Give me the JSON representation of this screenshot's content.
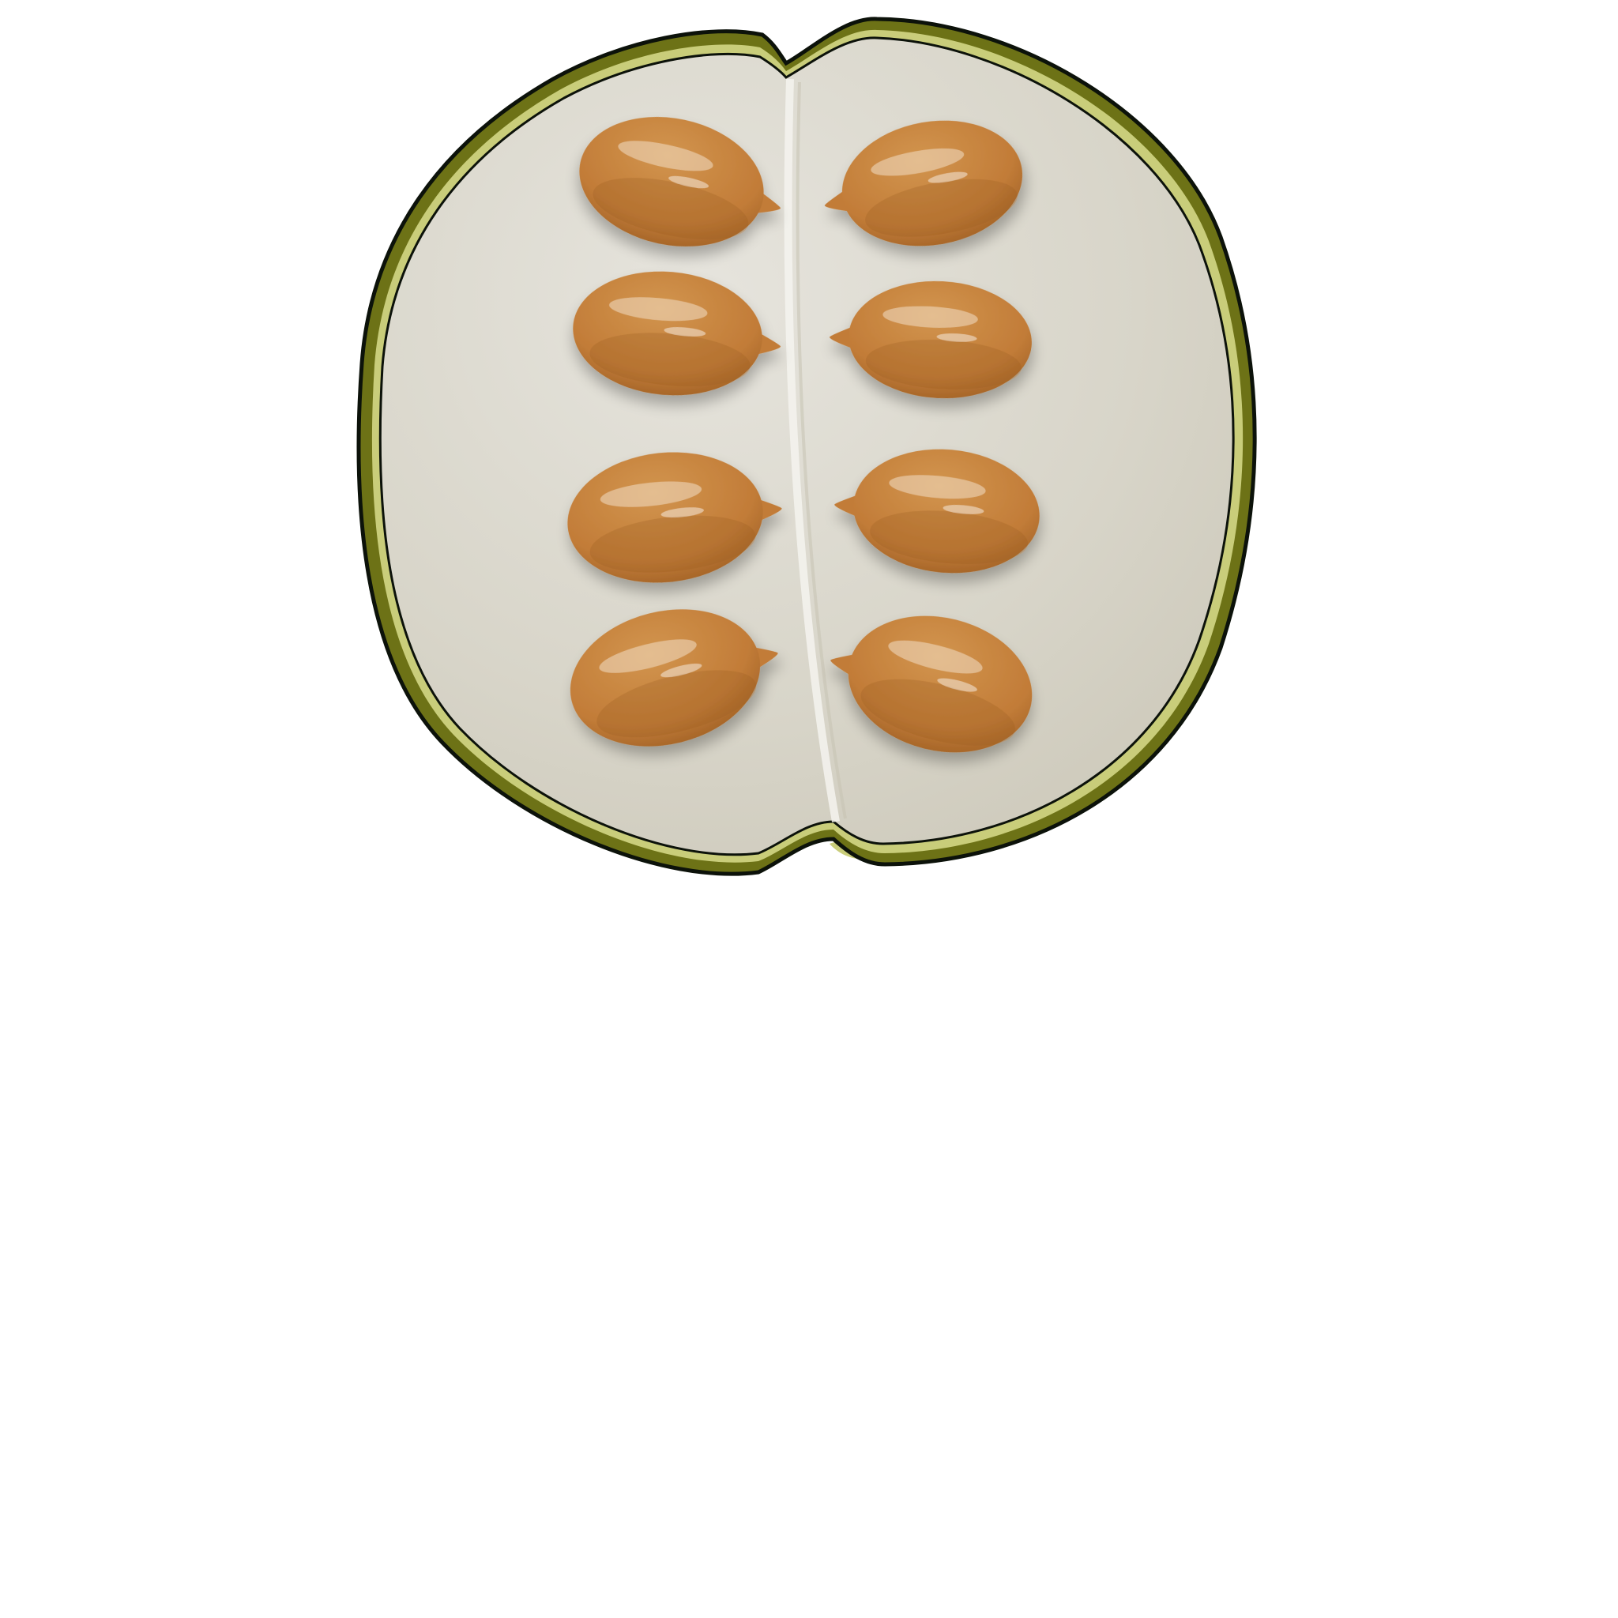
{
  "scene": {
    "subject": "fruit-cross-section-with-seeds",
    "colors": {
      "background": "#ffffff",
      "rind_outline": "#0c120a",
      "rind_green": "#6d7216",
      "rind_yellow": "#c9cd7a",
      "flesh_light": "#e6e4dd",
      "flesh_mid": "#d8d5c9",
      "flesh_dark": "#cbc7b8",
      "seed_light": "#d2954e",
      "seed_mid": "#c27c38",
      "seed_dark": "#9a5c22",
      "seed_highlight": "#f3dfc6"
    },
    "seed_count": 8,
    "seed_layout": {
      "columns": 2,
      "rows": 4,
      "tip_direction": "toward-center"
    }
  }
}
